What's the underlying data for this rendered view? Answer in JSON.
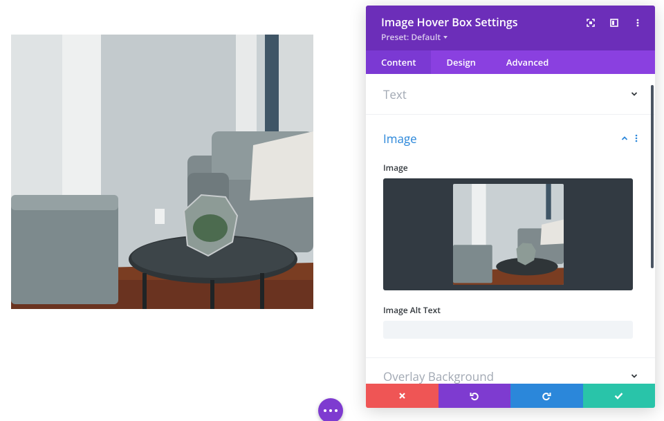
{
  "modal": {
    "title": "Image Hover Box Settings",
    "preset": "Preset: Default",
    "tabs": [
      {
        "label": "Content",
        "active": true
      },
      {
        "label": "Design",
        "active": false
      },
      {
        "label": "Advanced",
        "active": false
      }
    ],
    "sections": {
      "text": {
        "title": "Text"
      },
      "image": {
        "title": "Image",
        "image_label": "Image",
        "alt_label": "Image Alt Text",
        "alt_value": ""
      },
      "overlay": {
        "title": "Overlay Background"
      }
    }
  },
  "colors": {
    "header": "#6c2eb9",
    "tabs": "#8a40e0",
    "accent_blue": "#2b87da",
    "cancel": "#ef5555",
    "undo": "#7e3bd0",
    "redo": "#2b87da",
    "save": "#29c4a9"
  },
  "icons": {
    "header": [
      "focus-icon",
      "split-view-icon",
      "more-vertical-icon"
    ],
    "footer": [
      "close-icon",
      "undo-icon",
      "redo-icon",
      "check-icon"
    ]
  }
}
